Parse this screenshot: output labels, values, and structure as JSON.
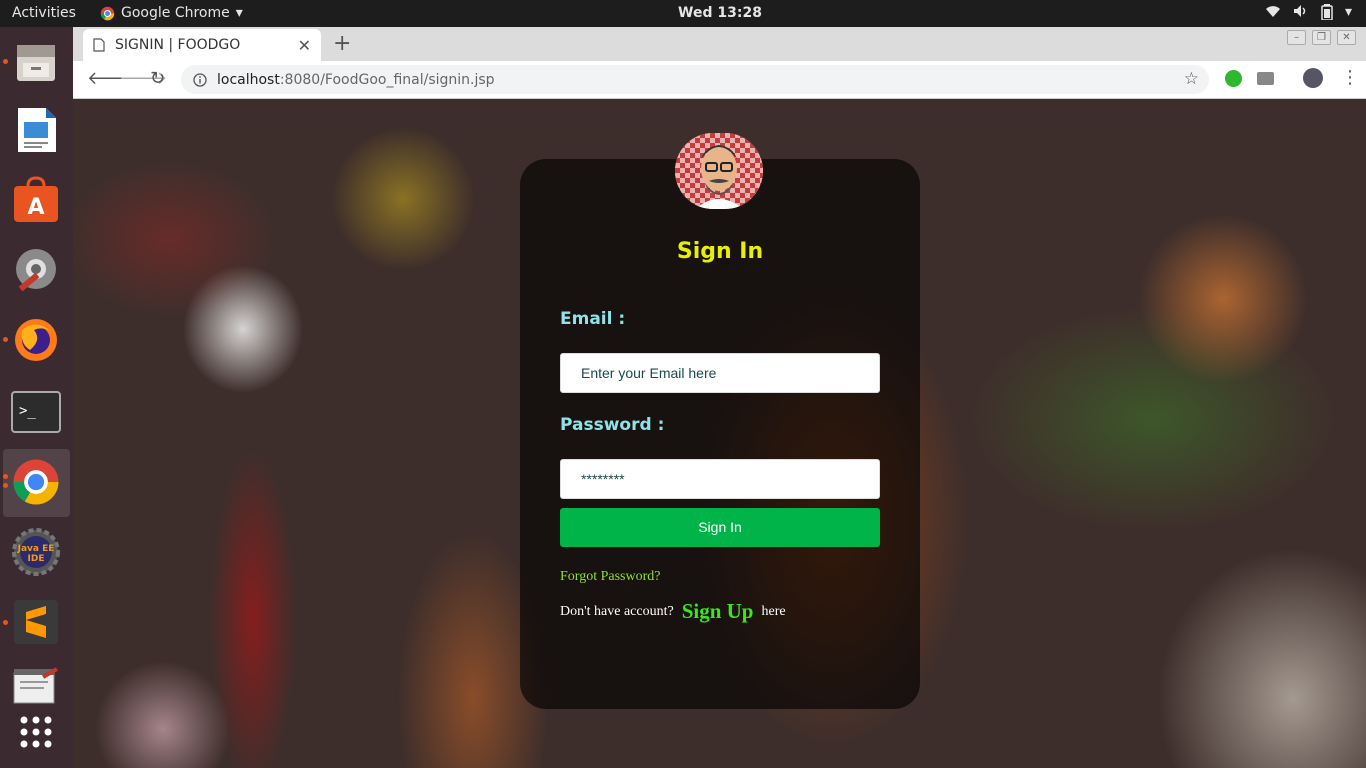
{
  "topbar": {
    "activities": "Activities",
    "app_name": "Google Chrome",
    "clock": "Wed 13:28"
  },
  "browser": {
    "tab_title": "SIGNIN | FOODGO",
    "url_host": "localhost",
    "url_path": ":8080/FoodGoo_final/signin.jsp"
  },
  "signin": {
    "heading": "Sign In",
    "email_label": "Email :",
    "email_placeholder": "Enter your Email here",
    "password_label": "Password :",
    "password_value": "********",
    "submit_label": "Sign In",
    "forgot_label": "Forgot Password?",
    "no_account_text": "Don't have account?",
    "signup_label": "Sign Up",
    "here_text": "here"
  },
  "dock": {
    "items": [
      "files-icon",
      "writer-icon",
      "software-icon",
      "settings-icon",
      "firefox-icon",
      "terminal-icon",
      "chrome-icon",
      "eclipse-icon",
      "sublime-icon",
      "text-editor-icon",
      "app-grid-icon"
    ]
  },
  "colors": {
    "heading": "#e8f000",
    "label": "#8ee3e8",
    "button": "#00b44a",
    "signup_link": "#39e81a"
  }
}
